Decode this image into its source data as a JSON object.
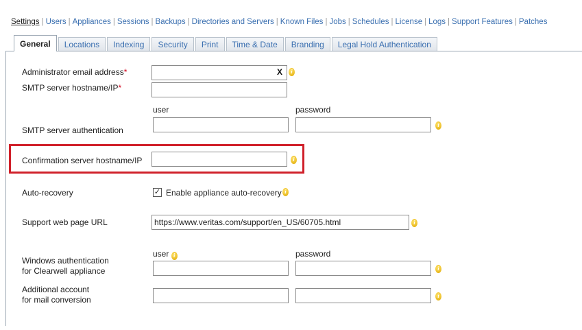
{
  "topnav": [
    "Settings",
    "Users",
    "Appliances",
    "Sessions",
    "Backups",
    "Directories and Servers",
    "Known Files",
    "Jobs",
    "Schedules",
    "License",
    "Logs",
    "Support Features",
    "Patches"
  ],
  "tabs": [
    "General",
    "Locations",
    "Indexing",
    "Security",
    "Print",
    "Time & Date",
    "Branding",
    "Legal Hold Authentication"
  ],
  "form": {
    "admin_email_label": "Administrator email address",
    "smtp_host_label": "SMTP server hostname/IP",
    "required_mark": "*",
    "clear_mark": "X",
    "user_label": "user",
    "password_label": "password",
    "smtp_auth_label": "SMTP server authentication",
    "confirm_label": "Confirmation server hostname/IP",
    "autorecovery_label": "Auto-recovery",
    "autorecovery_checkbox": "Enable appliance auto-recovery",
    "autorecovery_checked": true,
    "support_url_label": "Support web page URL",
    "support_url_value": "https://www.veritas.com/support/en_US/60705.html",
    "win_auth_label_1": "Windows authentication",
    "win_auth_label_2": "for Clearwell appliance",
    "add_account_label_1": "Additional account",
    "add_account_label_2": "for mail conversion"
  },
  "colors": {
    "link": "#3a6fb0",
    "highlight": "#d0202a",
    "required": "#d0021b"
  }
}
